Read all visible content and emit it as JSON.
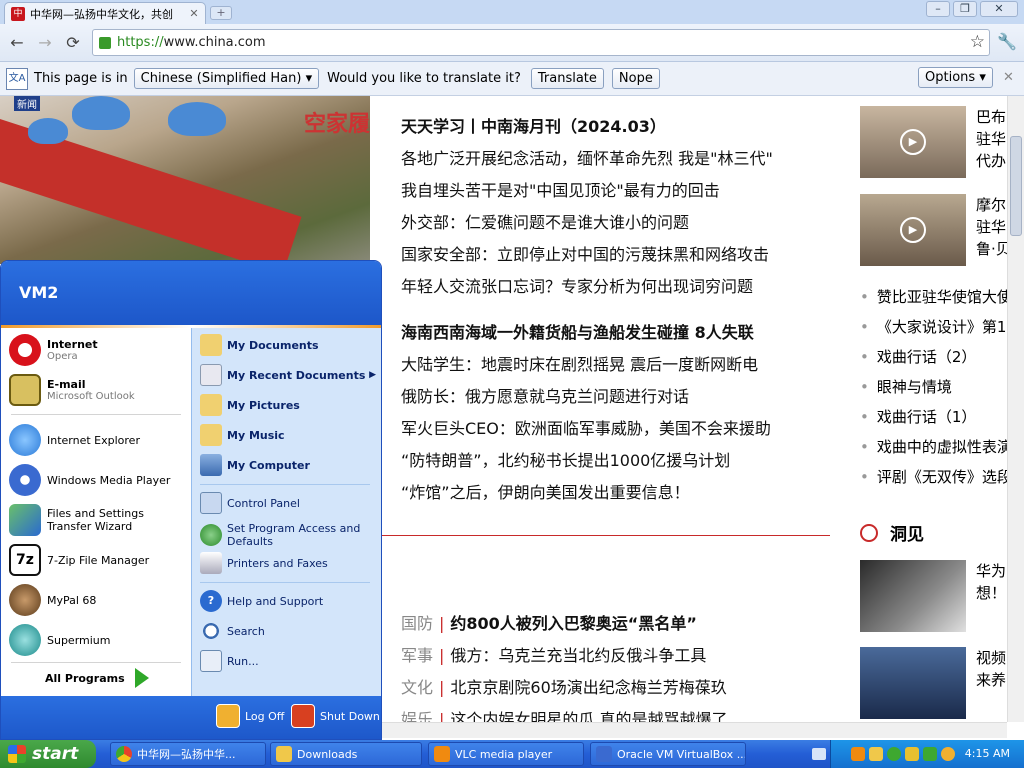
{
  "browser": {
    "tab_title": "中华网—弘扬中华文化，共创",
    "url_scheme": "https://",
    "url_rest": "www.china.com",
    "window_controls": [
      "–",
      "❐",
      "✕"
    ]
  },
  "translate_bar": {
    "prompt": "This page is in",
    "language": "Chinese (Simplified Han)",
    "question": "Would you like to translate it?",
    "translate_label": "Translate",
    "nope_label": "Nope",
    "options_label": "Options"
  },
  "photo": {
    "badge": "新闻",
    "sign_text": "空家履"
  },
  "news_block_1": {
    "headline": "天天学习丨中南海月刊（2024.03）",
    "items": [
      "各地广泛开展纪念活动，缅怀革命先烈 我是\"林三代\"",
      "我自埋头苦干是对\"中国见顶论\"最有力的回击",
      "外交部：仁爱礁问题不是谁大谁小的问题",
      "国家安全部：立即停止对中国的污蔑抹黑和网络攻击",
      "年轻人交流张口忘词？专家分析为何出现词穷问题"
    ]
  },
  "news_block_2": {
    "headline": "海南西南海域一外籍货船与渔船发生碰撞 8人失联",
    "items": [
      "大陆学生：地震时床在剧烈摇晃 震后一度断网断电",
      "俄防长：俄方愿意就乌克兰问题进行对话",
      "军火巨头CEO：欧洲面临军事威胁，美国不会来援助",
      "“防特朗普”，北约秘书长提出1000亿援乌计划",
      "“炸馆”之后，伊朗向美国发出重要信息！"
    ]
  },
  "news_block_3": [
    {
      "cat": "国防",
      "text": "约800人被列入巴黎奥运“黑名单”",
      "bold": true
    },
    {
      "cat": "军事",
      "text": "俄方：乌克兰充当北约反俄斗争工具",
      "bold": false
    },
    {
      "cat": "文化",
      "text": "北京京剧院60场演出纪念梅兰芳梅葆玖",
      "bold": false
    },
    {
      "cat": "娱乐",
      "text": "这个内娱女明星的瓜 真的是越骂越爆了",
      "bold": false
    }
  ],
  "right_column": {
    "video1_text": [
      "巴布",
      "驻华",
      "代办"
    ],
    "video2_text": [
      "摩尔",
      "驻华",
      "鲁·贝"
    ],
    "bullets": [
      "赞比亚驻华使馆大使",
      "《大家说设计》第1",
      "戏曲行话（2）",
      "眼神与情境",
      "戏曲行话（1）",
      "戏曲中的虚拟性表演",
      "评剧《无双传》选段"
    ],
    "section_title": "洞见",
    "card1_text": [
      "华为",
      "想！"
    ],
    "card2_text": [
      "视频",
      "来养"
    ]
  },
  "start_menu": {
    "user": "VM2",
    "pinned": [
      {
        "name": "Internet",
        "sub": "Opera",
        "icon": "opera-icon",
        "color": "#d8111b"
      },
      {
        "name": "E-mail",
        "sub": "Microsoft Outlook",
        "icon": "outlook-icon",
        "color": "#c8b040"
      }
    ],
    "recent": [
      {
        "name": "Internet Explorer",
        "icon": "ie-icon",
        "color": "#2a7ad8"
      },
      {
        "name": "Windows Media Player",
        "icon": "media-player-icon",
        "color": "#3a6ad0"
      },
      {
        "name": "Files and Settings Transfer Wizard",
        "icon": "transfer-wizard-icon",
        "color": "#4aa04a"
      },
      {
        "name": "7-Zip File Manager",
        "icon": "7zip-icon",
        "color": "#111111"
      },
      {
        "name": "MyPal 68",
        "icon": "mypal-icon",
        "color": "#8a5a2a"
      },
      {
        "name": "Supermium",
        "icon": "supermium-icon",
        "color": "#2aa0a0"
      }
    ],
    "all_programs": "All Programs",
    "right_top": [
      {
        "name": "My Documents",
        "icon": "folder-documents-icon"
      },
      {
        "name": "My Recent Documents",
        "icon": "recent-documents-icon"
      },
      {
        "name": "My Pictures",
        "icon": "folder-pictures-icon"
      },
      {
        "name": "My Music",
        "icon": "folder-music-icon"
      },
      {
        "name": "My Computer",
        "icon": "computer-icon"
      }
    ],
    "right_mid": [
      {
        "name": "Control Panel",
        "icon": "control-panel-icon"
      },
      {
        "name": "Set Program Access and Defaults",
        "icon": "program-defaults-icon"
      },
      {
        "name": "Printers and Faxes",
        "icon": "printer-icon"
      }
    ],
    "right_bottom": [
      {
        "name": "Help and Support",
        "icon": "help-icon"
      },
      {
        "name": "Search",
        "icon": "search-icon"
      },
      {
        "name": "Run...",
        "icon": "run-icon"
      }
    ],
    "log_off": "Log Off",
    "shut_down": "Shut Down"
  },
  "taskbar": {
    "start_label": "start",
    "tasks": [
      {
        "label": "中华网—弘扬中华...",
        "icon": "chrome-icon",
        "color": "#e8a020"
      },
      {
        "label": "Downloads",
        "icon": "folder-icon",
        "color": "#f0c84a"
      },
      {
        "label": "VLC media player",
        "icon": "vlc-icon",
        "color": "#f08a10"
      },
      {
        "label": "Oracle VM VirtualBox ...",
        "icon": "virtualbox-icon",
        "color": "#3a6ad0"
      }
    ],
    "clock": "4:15 AM"
  }
}
